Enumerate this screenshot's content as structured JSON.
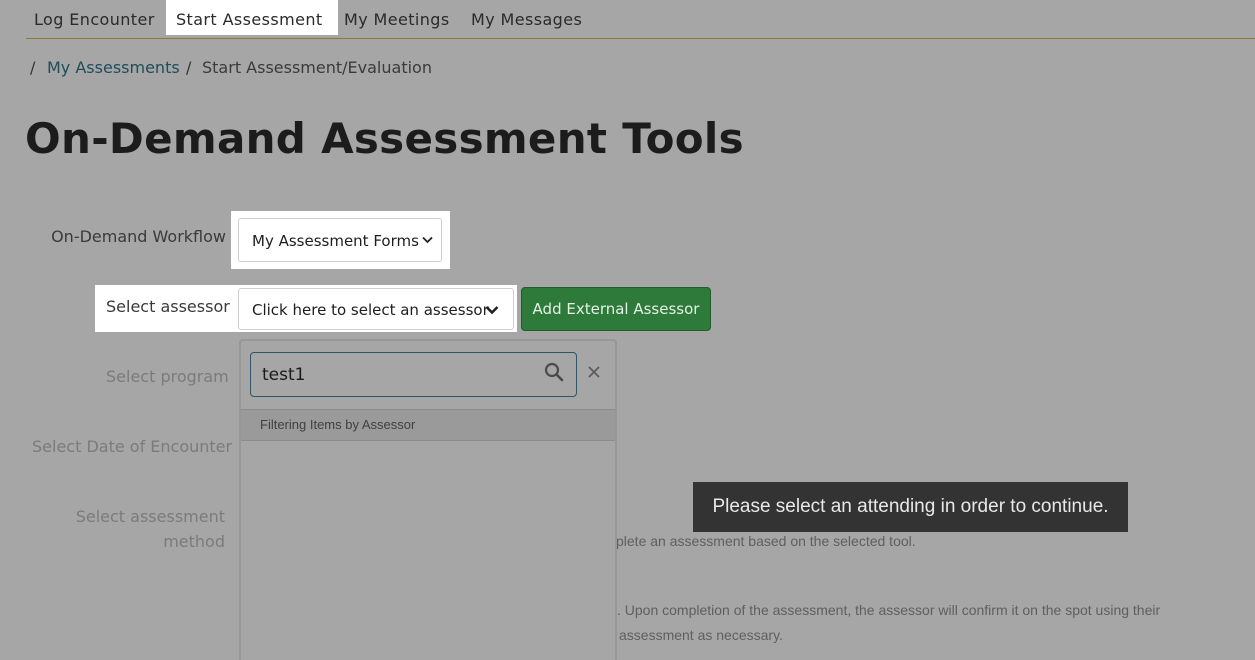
{
  "nav": {
    "items": [
      {
        "label": "Log Encounter"
      },
      {
        "label": "Start Assessment"
      },
      {
        "label": "My Meetings"
      },
      {
        "label": "My Messages"
      }
    ]
  },
  "breadcrumb": {
    "separator": "/",
    "link": "My Assessments",
    "current": "Start Assessment/Evaluation"
  },
  "page": {
    "title": "On-Demand Assessment Tools"
  },
  "form": {
    "workflow_label": "On-Demand Workflow",
    "workflow_value": "My Assessment Forms",
    "assessor_label": "Select assessor",
    "assessor_value": "Click here to select an assessor",
    "add_external_label": "Add External Assessor",
    "program_label": "Select program",
    "date_label": "Select Date of Encounter",
    "method_label_line1": "Select assessment",
    "method_label_line2": "method"
  },
  "dropdown": {
    "search_value": "test1",
    "filter_label": "Filtering Items by Assessor"
  },
  "tooltip": {
    "text": "Please select an attending in order to continue."
  },
  "descriptions": {
    "line1": "plete an assessment based on the selected tool.",
    "line2": ". Upon completion of the assessment, the assessor will confirm it on the spot using their",
    "line3": "assessment as necessary."
  },
  "colors": {
    "overlay": "#a6a6a6",
    "accent_green": "#2d7a3a",
    "link": "#1f4d5a",
    "tooltip_bg": "#333333"
  }
}
